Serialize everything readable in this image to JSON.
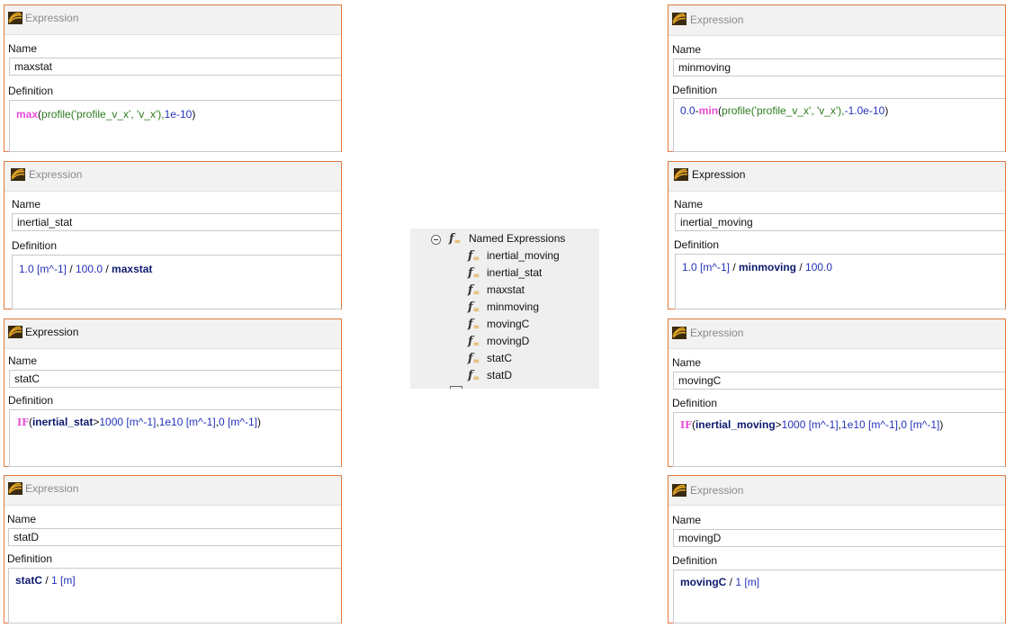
{
  "panel_header": "Expression",
  "name_label": "Name",
  "definition_label": "Definition",
  "panels": {
    "maxstat": {
      "name": "maxstat",
      "def": [
        "max",
        "(",
        "profile(",
        "'profile_v_x'",
        ", ",
        "'v_x'",
        "),",
        "1e-10",
        ")"
      ]
    },
    "inertial_stat": {
      "name": "inertial_stat",
      "def": [
        "1.0 [m^-1]",
        " / ",
        "100.0",
        " / ",
        "maxstat"
      ]
    },
    "statC": {
      "name": "statC",
      "def": [
        "IF",
        "(",
        "inertial_stat",
        ">",
        "1000 [m^-1]",
        ",",
        "1e10 [m^-1]",
        ",",
        "0 [m^-1]",
        ")"
      ]
    },
    "statD": {
      "name": "statD",
      "def": [
        "statC",
        " / ",
        "1 [m]"
      ]
    },
    "minmoving": {
      "name": "minmoving",
      "def": [
        "0.0",
        "-",
        "min",
        "(",
        "profile(",
        "'profile_v_x'",
        ", ",
        "'v_x'",
        "),",
        "-1.0e-10",
        ")"
      ]
    },
    "inertial_moving": {
      "name": "inertial_moving",
      "def": [
        "1.0 [m^-1]",
        " / ",
        "minmoving",
        " / ",
        "100.0"
      ]
    },
    "movingC": {
      "name": "movingC",
      "def": [
        "IF",
        "(",
        "inertial_moving",
        ">",
        "1000 [m^-1]",
        ",",
        "1e10 [m^-1]",
        ",",
        "0 [m^-1]",
        ")"
      ]
    },
    "movingD": {
      "name": "movingD",
      "def": [
        "movingC",
        " / ",
        "1 [m]"
      ]
    }
  },
  "tree": {
    "root_label": "Named Expressions",
    "root_icon": "fx-icon",
    "items": [
      "inertial_moving",
      "inertial_stat",
      "maxstat",
      "minmoving",
      "movingC",
      "movingD",
      "statC",
      "statD"
    ]
  },
  "colors": {
    "panel_border": "#e07a3e",
    "function": "#e84bd8",
    "string": "#2d7a1e",
    "number": "#2433b8",
    "variable": "#0d1a6e"
  }
}
